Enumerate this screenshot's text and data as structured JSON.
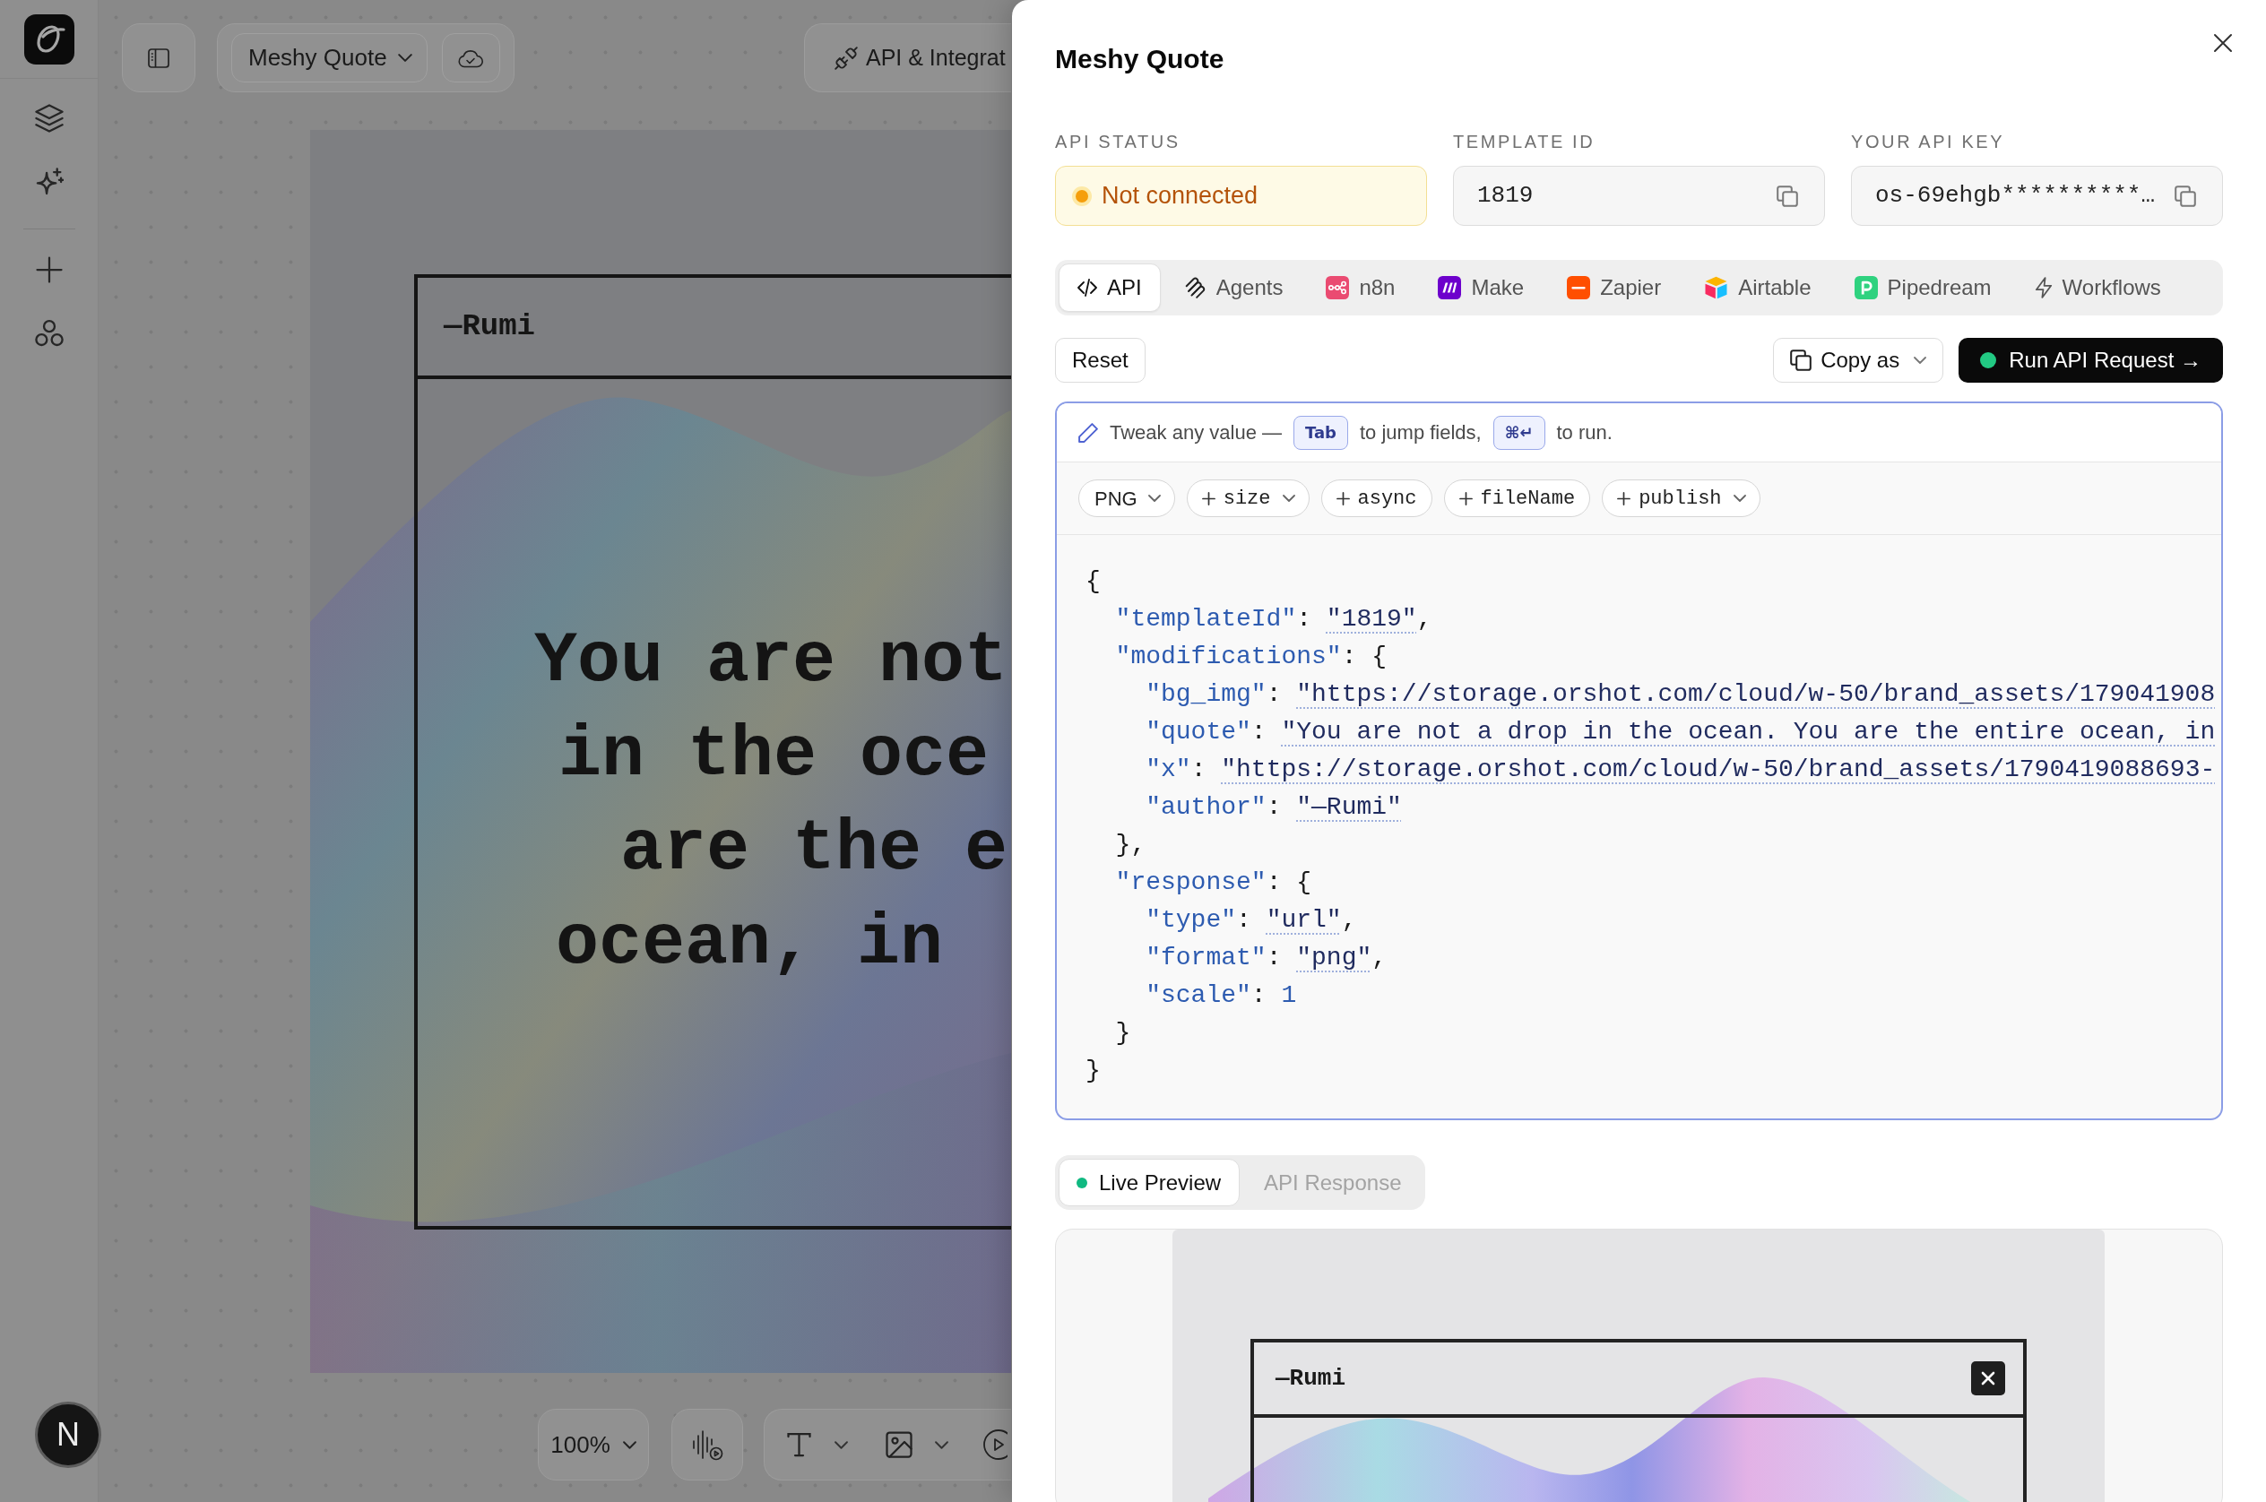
{
  "toolbar": {
    "project_name": "Meshy Quote",
    "integrations_button": "API & Integrat"
  },
  "canvas": {
    "author": "—Rumi",
    "quote_lines": [
      "You are not",
      "in the oce",
      "are the e",
      "ocean, in"
    ],
    "zoom": "100%"
  },
  "dev_button": {
    "label": "N"
  },
  "panel": {
    "title": "Meshy Quote",
    "status": {
      "label": "API STATUS",
      "text": "Not connected",
      "connected": false
    },
    "template_id": {
      "label": "TEMPLATE ID",
      "value": "1819"
    },
    "api_key": {
      "label": "YOUR API KEY",
      "value": "os-69ehgb**********…"
    },
    "tabs": [
      {
        "label": "API",
        "selected": true
      },
      {
        "label": "Agents",
        "selected": false
      },
      {
        "label": "n8n",
        "selected": false
      },
      {
        "label": "Make",
        "selected": false
      },
      {
        "label": "Zapier",
        "selected": false
      },
      {
        "label": "Airtable",
        "selected": false
      },
      {
        "label": "Pipedream",
        "selected": false
      },
      {
        "label": "Workflows",
        "selected": false
      }
    ],
    "reset_button": "Reset",
    "copy_button": "Copy as",
    "run_button": "Run API Request →",
    "editor": {
      "hint": [
        {
          "kind": "text",
          "text": "Tweak any value —"
        },
        {
          "kind": "key",
          "text": "Tab"
        },
        {
          "kind": "text",
          "text": "to jump fields,"
        },
        {
          "kind": "key",
          "text": "⌘↵"
        },
        {
          "kind": "text",
          "text": "to run."
        }
      ],
      "chips": [
        {
          "kind": "dropdown",
          "label": "PNG"
        },
        {
          "kind": "add_dropdown",
          "label": "size"
        },
        {
          "kind": "add",
          "label": "async"
        },
        {
          "kind": "add",
          "label": "fileName"
        },
        {
          "kind": "add_dropdown",
          "label": "publish"
        }
      ],
      "code": {
        "open": "{",
        "close": "}",
        "members": [
          {
            "key": "\"templateId\"",
            "colon": ":",
            "kind": "string",
            "value": "\"1819\"",
            "comma": ","
          },
          {
            "key": "\"modifications\"",
            "colon": ":",
            "kind": "object",
            "open": "{",
            "members": [
              {
                "key": "\"bg_img\"",
                "colon": ":",
                "kind": "string",
                "value": "\"https://storage.orshot.com/cloud/w-50/brand_assets/179041908"
              },
              {
                "key": "\"quote\"",
                "colon": ":",
                "kind": "string",
                "value": "\"You are not a drop in the ocean. You are the entire ocean, in"
              },
              {
                "key": "\"x\"",
                "colon": ":",
                "kind": "string",
                "value": "\"https://storage.orshot.com/cloud/w-50/brand_assets/1790419088693-"
              },
              {
                "key": "\"author\"",
                "colon": ":",
                "kind": "string",
                "value": "\"—Rumi\""
              }
            ],
            "close": "}",
            "comma": ","
          },
          {
            "key": "\"response\"",
            "colon": ":",
            "kind": "object",
            "open": "{",
            "members": [
              {
                "key": "\"type\"",
                "colon": ":",
                "kind": "string",
                "value": "\"url\"",
                "comma": ","
              },
              {
                "key": "\"format\"",
                "colon": ":",
                "kind": "string",
                "value": "\"png\"",
                "comma": ","
              },
              {
                "key": "\"scale\"",
                "colon": ":",
                "kind": "number",
                "value": "1"
              }
            ],
            "close": "}"
          }
        ]
      }
    },
    "preview": {
      "tabs": [
        {
          "label": "Live Preview",
          "selected": true
        },
        {
          "label": "API Response",
          "selected": false
        }
      ],
      "author": "—Rumi"
    }
  }
}
